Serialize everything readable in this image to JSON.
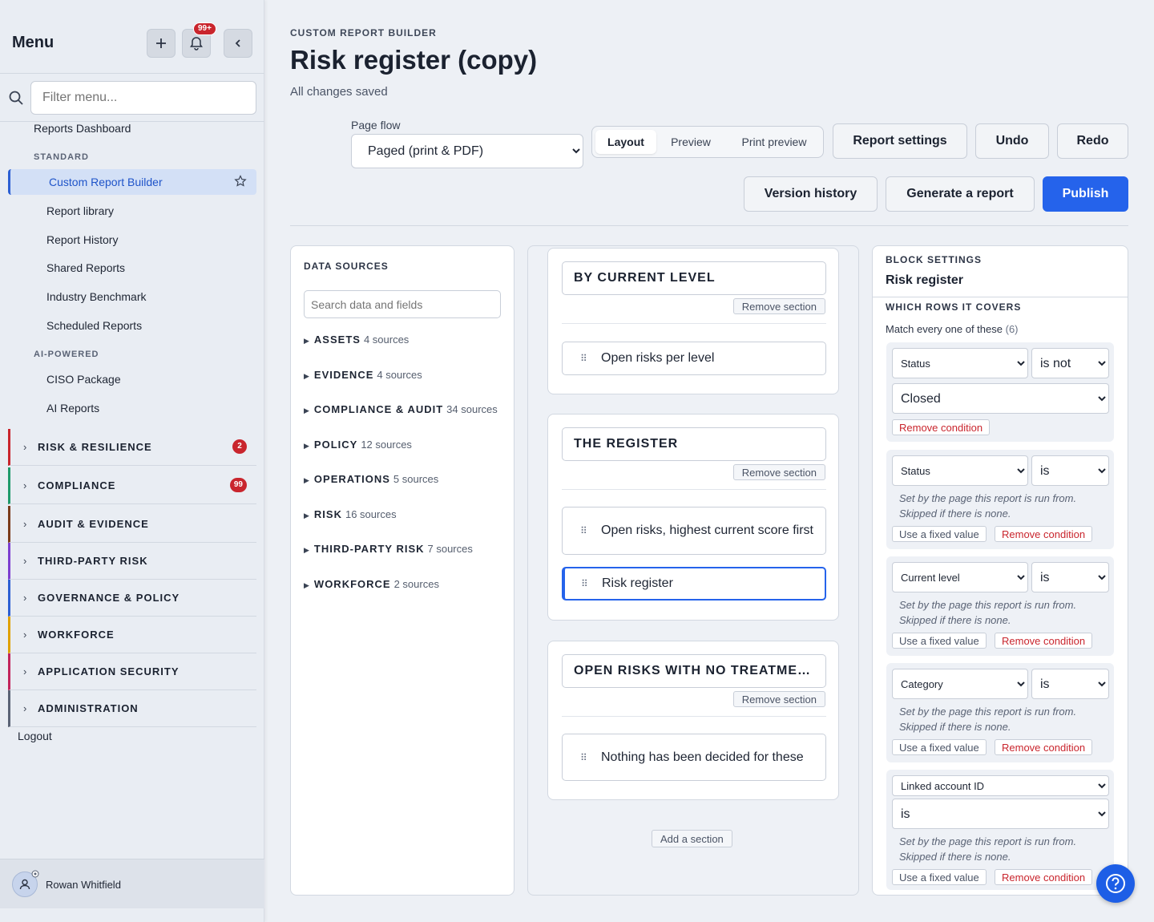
{
  "sidebar": {
    "title": "Menu",
    "notif_count": "99+",
    "search_placeholder": "Filter menu...",
    "top_link": "Reports Dashboard",
    "group_standard": "STANDARD",
    "active_item": "Custom Report Builder",
    "standard_items": [
      "Report library",
      "Report History",
      "Shared Reports",
      "Industry Benchmark",
      "Scheduled Reports"
    ],
    "group_ai": "AI-POWERED",
    "ai_items": [
      "CISO Package",
      "AI Reports"
    ],
    "categories": [
      {
        "label": "RISK & RESILIENCE",
        "badge": "2",
        "color": "#c9252d"
      },
      {
        "label": "COMPLIANCE",
        "badge": "99",
        "color": "#1f9a6b"
      },
      {
        "label": "AUDIT & EVIDENCE",
        "badge": "",
        "color": "#7a3b1c"
      },
      {
        "label": "THIRD-PARTY RISK",
        "badge": "",
        "color": "#7d3fd0"
      },
      {
        "label": "GOVERNANCE & POLICY",
        "badge": "",
        "color": "#2c5fd3"
      },
      {
        "label": "WORKFORCE",
        "badge": "",
        "color": "#e0a100"
      },
      {
        "label": "APPLICATION SECURITY",
        "badge": "",
        "color": "#c2255c"
      },
      {
        "label": "ADMINISTRATION",
        "badge": "",
        "color": "#5a6375"
      }
    ],
    "logout": "Logout",
    "user_name": "Rowan Whitfield"
  },
  "header": {
    "eyebrow": "CUSTOM REPORT BUILDER",
    "title": "Risk register (copy)",
    "status": "All changes saved",
    "page_flow_label": "Page flow",
    "page_flow_value": "Paged (print & PDF)",
    "view_tabs": [
      "Layout",
      "Preview",
      "Print preview"
    ],
    "buttons": {
      "report_settings": "Report settings",
      "undo": "Undo",
      "redo": "Redo",
      "version_history": "Version history",
      "generate": "Generate a report",
      "publish": "Publish"
    }
  },
  "data_sources": {
    "title": "DATA SOURCES",
    "search_placeholder": "Search data and fields",
    "groups": [
      {
        "name": "ASSETS",
        "count": "4 sources"
      },
      {
        "name": "EVIDENCE",
        "count": "4 sources"
      },
      {
        "name": "COMPLIANCE & AUDIT",
        "count": "34 sources"
      },
      {
        "name": "POLICY",
        "count": "12 sources"
      },
      {
        "name": "OPERATIONS",
        "count": "5 sources"
      },
      {
        "name": "RISK",
        "count": "16 sources"
      },
      {
        "name": "THIRD-PARTY RISK",
        "count": "7 sources"
      },
      {
        "name": "WORKFORCE",
        "count": "2 sources"
      }
    ]
  },
  "canvas": {
    "remove_section": "Remove section",
    "add_section": "Add a section",
    "sections": [
      {
        "title": "BY CURRENT LEVEL",
        "blocks": [
          "Open risks per level"
        ]
      },
      {
        "title": "THE REGISTER",
        "blocks": [
          "Open risks, highest current score first",
          "Risk register"
        ]
      },
      {
        "title": "OPEN RISKS WITH NO TREATMEN...",
        "blocks": [
          "Nothing has been decided for these"
        ]
      }
    ]
  },
  "block_settings": {
    "eyebrow": "BLOCK SETTINGS",
    "title": "Risk register",
    "rows_heading": "WHICH ROWS IT COVERS",
    "match_text": "Match every one of these",
    "match_count": "(6)",
    "hint": "Set by the page this report is run from. Skipped if there is none.",
    "use_fixed": "Use a fixed value",
    "remove_condition": "Remove condition",
    "conditions": [
      {
        "field": "Status",
        "op": "is not",
        "value": "Closed"
      },
      {
        "field": "Status",
        "op": "is"
      },
      {
        "field": "Current level",
        "op": "is"
      },
      {
        "field": "Category",
        "op": "is"
      },
      {
        "field": "Linked account ID",
        "op": "is"
      }
    ]
  },
  "icons": [
    "plus-icon",
    "bell-icon",
    "chevron-left-icon",
    "search-icon",
    "star-icon",
    "chevron-right-icon",
    "user-icon",
    "gear-icon",
    "help-icon",
    "drag-handle-icon",
    "triangle-right-icon"
  ]
}
